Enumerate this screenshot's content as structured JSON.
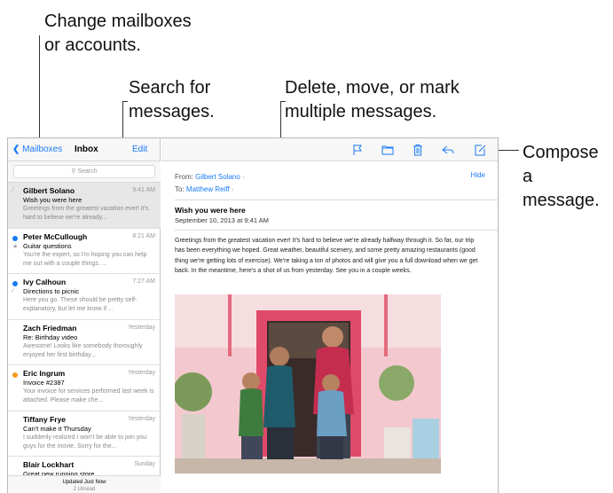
{
  "callouts": {
    "mailboxes": "Change mailboxes\nor accounts.",
    "search": "Search for\nmessages.",
    "multi": "Delete, move, or mark\nmultiple messages.",
    "compose": "Compose a\nmessage."
  },
  "list": {
    "back_label": "Mailboxes",
    "title": "Inbox",
    "edit_label": "Edit",
    "search_placeholder": "Search",
    "messages": [
      {
        "sender": "Gilbert Solano",
        "time": "9:41 AM",
        "subject": "Wish you were here",
        "preview": "Greetings from the greatest vacation ever! It's hard to believe we're already..."
      },
      {
        "sender": "Peter McCullough",
        "time": "8:21 AM",
        "subject": "Guitar questions",
        "preview": "You're the expert, so I'm hoping you can help me out with a couple things. ..."
      },
      {
        "sender": "Ivy Calhoun",
        "time": "7:27 AM",
        "subject": "Directions to picnic",
        "preview": "Here you go. These should be pretty self-explanatory, but let me know if ..."
      },
      {
        "sender": "Zach Friedman",
        "time": "Yesterday",
        "subject": "Re: Birthday video",
        "preview": "Awesome! Looks like somebody thoroughly enjoyed her first birthday..."
      },
      {
        "sender": "Eric Ingrum",
        "time": "Yesterday",
        "subject": "Invoice #2387",
        "preview": "Your invoice for services performed last week is attached. Please make che..."
      },
      {
        "sender": "Tiffany Frye",
        "time": "Yesterday",
        "subject": "Can't make it Thursday",
        "preview": "I suddenly realized I won't be able to join you guys for the movie. Sorry for the..."
      },
      {
        "sender": "Blair Lockhart",
        "time": "Sunday",
        "subject": "Great new running store",
        "preview": ""
      }
    ],
    "footer_status": "Updated Just Now",
    "footer_unread": "2 Unread"
  },
  "detail": {
    "from_label": "From:",
    "from_name": "Gilbert Solano",
    "to_label": "To:",
    "to_name": "Matthew Reiff",
    "hide_label": "Hide",
    "subject": "Wish you were here",
    "date": "September 10, 2013 at 9:41 AM",
    "body": "Greetings from the greatest vacation ever! It's hard to believe we're already halfway through it. So far, our trip has been everything we hoped. Great weather, beautiful scenery, and some pretty amazing restaurants (good thing we're getting lots of exercise). We're taking a ton of photos and will give you a full download when we get back. In the meantime, here's a shot of us from yesterday. See you in a couple weeks."
  },
  "toolbar_icons": [
    "flag-icon",
    "folder-icon",
    "trash-icon",
    "reply-icon",
    "compose-icon"
  ],
  "colors": {
    "accent": "#1a7bf5",
    "unread_dot": "#1a7bf5",
    "flag_dot": "#f59d1b"
  }
}
